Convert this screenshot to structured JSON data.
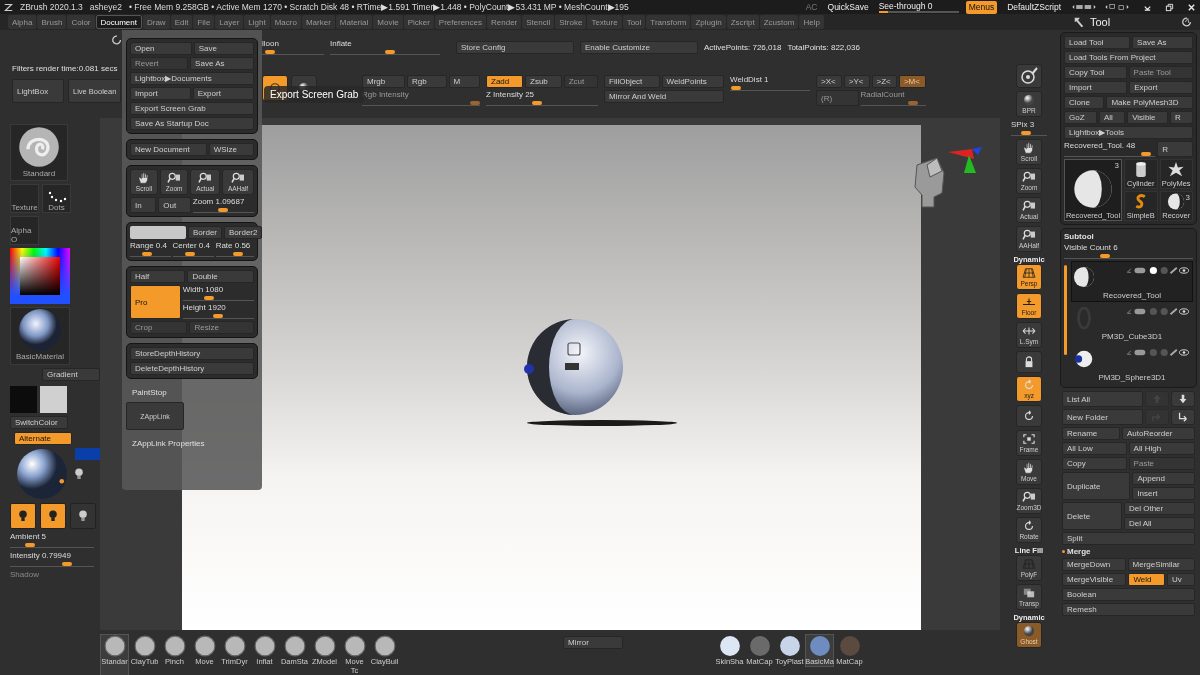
{
  "title_bar": {
    "app": "ZBrush 2020.1.3",
    "user": "asheye2",
    "stats": "• Free Mem 9.258GB • Active Mem 1270 • Scratch Disk 48 •  RTime▶1.591 Timer▶1.448 • PolyCount▶53.431 MP  • MeshCount▶195",
    "ac": "AC",
    "quicksave": "QuickSave",
    "see_through": {
      "label": "See-through  0",
      "level": 0.12
    },
    "menus": {
      "label": "Menus",
      "on": true
    },
    "script": "DefaultZScript"
  },
  "menu_bar": {
    "items": [
      {
        "label": "Alpha",
        "selected": false
      },
      {
        "label": "Brush",
        "selected": false
      },
      {
        "label": "Color",
        "selected": false
      },
      {
        "label": "Document",
        "selected": true
      },
      {
        "label": "Draw",
        "selected": false
      },
      {
        "label": "Edit",
        "selected": false
      },
      {
        "label": "File",
        "selected": false
      },
      {
        "label": "Layer",
        "selected": false
      },
      {
        "label": "Light",
        "selected": false
      },
      {
        "label": "Macro",
        "selected": false
      },
      {
        "label": "Marker",
        "selected": false
      },
      {
        "label": "Material",
        "selected": false
      },
      {
        "label": "Movie",
        "selected": false
      },
      {
        "label": "Picker",
        "selected": false
      },
      {
        "label": "Preferences",
        "selected": false
      },
      {
        "label": "Render",
        "selected": false
      },
      {
        "label": "Stencil",
        "selected": false
      },
      {
        "label": "Stroke",
        "selected": false
      },
      {
        "label": "Texture",
        "selected": false
      },
      {
        "label": "Tool",
        "selected": false
      },
      {
        "label": "Transform",
        "selected": false
      },
      {
        "label": "Zplugin",
        "selected": false
      },
      {
        "label": "Zscript",
        "selected": false
      },
      {
        "label": "Zcustom",
        "selected": false
      },
      {
        "label": "Help",
        "selected": false
      }
    ],
    "palette_title": "Tool"
  },
  "left_shelf": {
    "filter_text": "Filters render time:0.081 secs",
    "lightbox": "LightBox",
    "live_boolean": "Live Boolean",
    "brush": "Standard",
    "texture": "Texture",
    "stroke": "Dots",
    "alpha": "Alpha O",
    "material": "BasicMaterial",
    "gradient": "Gradient",
    "switch_color": "SwitchColor",
    "alternate": {
      "label": "Alternate",
      "on": true
    },
    "lights": [
      {
        "on": true
      },
      {
        "on": true
      },
      {
        "on": false
      }
    ],
    "ambient": {
      "label": "Ambient 5",
      "level": 0.2
    },
    "intensity": {
      "label": "Intensity 0.79949",
      "level": 0.7
    },
    "shadow": "Shadow"
  },
  "top_toolbar": {
    "row": [
      {
        "kind": "slider",
        "label": "lloon",
        "level": 0.05,
        "disabled": false
      },
      {
        "kind": "slider",
        "label": "Inflate",
        "level": 0.55,
        "disabled": false
      },
      {
        "kind": "button",
        "label": "Store Config",
        "on": false,
        "disabled": false
      },
      {
        "kind": "button",
        "label": "Enable Customize",
        "on": false,
        "disabled": false
      },
      {
        "kind": "text",
        "label": "ActivePoints: 726,018"
      },
      {
        "kind": "text",
        "label": "TotalPoints: 822,036"
      }
    ],
    "groups": [
      {
        "top": [
          {
            "kind": "button",
            "label": "Mrgb",
            "on": false,
            "disabled": false
          },
          {
            "kind": "button",
            "label": "Rgb",
            "on": false,
            "disabled": false
          },
          {
            "kind": "button",
            "label": "M",
            "on": false,
            "disabled": false
          }
        ],
        "bottom": [
          {
            "kind": "slider",
            "label": "Rgb Intensity",
            "level": 1,
            "disabled": true
          }
        ]
      },
      {
        "top": [
          {
            "kind": "button",
            "label": "Zadd",
            "on": true,
            "disabled": false
          },
          {
            "kind": "button",
            "label": "Zsub",
            "on": false,
            "disabled": false
          },
          {
            "kind": "button",
            "label": "Zcut",
            "on": false,
            "disabled": true
          }
        ],
        "bottom": [
          {
            "kind": "slider",
            "label": "Z Intensity 25",
            "level": 0.45,
            "disabled": false
          }
        ]
      },
      {
        "top": [
          {
            "kind": "button",
            "label": "FillObject",
            "on": false,
            "disabled": false
          },
          {
            "kind": "button",
            "label": "WeldPoints",
            "on": false,
            "disabled": false
          }
        ],
        "bottom": [
          {
            "kind": "button",
            "label": "Mirror And Weld",
            "on": false,
            "disabled": false
          }
        ]
      },
      {
        "top": [
          {
            "kind": "slider",
            "label": "WeldDist 1",
            "level": 0.02,
            "disabled": false
          }
        ]
      },
      {
        "top": [
          {
            "kind": "button",
            "label": ">X<",
            "on": false,
            "disabled": false
          },
          {
            "kind": "button",
            "label": ">Y<",
            "on": false,
            "disabled": false
          },
          {
            "kind": "button",
            "label": ">Z<",
            "on": false,
            "disabled": false
          },
          {
            "kind": "button",
            "label": ">M<",
            "on": true,
            "disabled": true
          }
        ],
        "bottom": [
          {
            "kind": "button",
            "label": "(R)",
            "on": false,
            "disabled": true
          },
          {
            "kind": "slider",
            "label": "RadialCount",
            "level": 0.85,
            "disabled": true
          }
        ]
      }
    ]
  },
  "tooltip": "Export Screen Grab",
  "document_menu": {
    "groups": [
      {
        "rows": [
          [
            {
              "kind": "button",
              "label": "Open",
              "on": false,
              "disabled": false
            },
            {
              "kind": "button",
              "label": "Save",
              "on": false,
              "disabled": false
            }
          ],
          [
            {
              "kind": "button",
              "label": "Revert",
              "on": false,
              "disabled": true
            },
            {
              "kind": "button",
              "label": "Save As",
              "on": false,
              "disabled": false
            }
          ],
          [
            {
              "kind": "button",
              "label": "Lightbox▶Documents",
              "on": false,
              "disabled": false
            }
          ],
          [
            {
              "kind": "button",
              "label": "Import",
              "on": false,
              "disabled": false
            },
            {
              "kind": "button",
              "label": "Export",
              "on": false,
              "disabled": false
            }
          ],
          [
            {
              "kind": "button",
              "label": "Export Screen Grab",
              "on": false,
              "disabled": false
            }
          ],
          [
            {
              "kind": "button",
              "label": "Save As Startup Doc",
              "on": false,
              "disabled": false
            }
          ]
        ]
      },
      {
        "rows": [
          [
            {
              "kind": "button",
              "label": "New Document",
              "on": false,
              "disabled": false
            },
            {
              "kind": "button",
              "label": "WSize",
              "on": false,
              "disabled": false
            }
          ]
        ]
      },
      {
        "rows": [
          [
            {
              "kind": "hand",
              "label": "Scroll",
              "on": false,
              "disabled": false
            },
            {
              "kind": "magnifier",
              "label": "Zoom",
              "on": false,
              "disabled": false
            },
            {
              "kind": "magnifier",
              "label": "Actual",
              "on": false,
              "disabled": false
            },
            {
              "kind": "magnifier",
              "label": "AAHalf",
              "on": false,
              "disabled": false
            }
          ],
          [
            {
              "kind": "button",
              "label": "In",
              "on": false,
              "disabled": false
            },
            {
              "kind": "button",
              "label": "Out",
              "on": false,
              "disabled": false
            },
            {
              "kind": "slider",
              "label": "Zoom 1.09687",
              "level": 0.5,
              "disabled": false
            }
          ]
        ]
      },
      {
        "rows": [
          [
            {
              "kind": "swatch"
            },
            {
              "kind": "button",
              "label": "Border",
              "on": false,
              "disabled": false
            },
            {
              "kind": "button",
              "label": "Border2",
              "on": false,
              "disabled": false
            }
          ],
          [
            {
              "kind": "slider",
              "label": "Range 0.4",
              "level": 0.4,
              "disabled": false
            },
            {
              "kind": "slider",
              "label": "Center 0.4",
              "level": 0.4,
              "disabled": false
            },
            {
              "kind": "slider",
              "label": "Rate 0.56",
              "level": 0.6,
              "disabled": false
            }
          ]
        ]
      },
      {
        "rows": [
          [
            {
              "kind": "button",
              "label": "Half",
              "on": false,
              "disabled": false
            },
            {
              "kind": "button",
              "label": "Double",
              "on": false,
              "disabled": false
            }
          ],
          [
            {
              "kind": "button",
              "label": "Pro",
              "on": true,
              "disabled": false
            },
            {
              "kind": "stack",
              "items": [
                {
                  "kind": "slider",
                  "label": "Width 1080",
                  "level": 0.35,
                  "disabled": false
                },
                {
                  "kind": "slider",
                  "label": "Height 1920",
                  "level": 0.5,
                  "disabled": false
                }
              ]
            }
          ],
          [
            {
              "kind": "button",
              "label": "Crop",
              "on": false,
              "disabled": true
            },
            {
              "kind": "button",
              "label": "Resize",
              "on": false,
              "disabled": true
            }
          ]
        ]
      },
      {
        "rows": [
          [
            {
              "kind": "button",
              "label": "StoreDepthHistory",
              "on": false,
              "disabled": false
            }
          ],
          [
            {
              "kind": "button",
              "label": "DeleteDepthHistory",
              "on": false,
              "disabled": false
            }
          ]
        ]
      }
    ],
    "paint_stop": "PaintStop",
    "zapplink": "ZAppLink",
    "zapplink_properties": "ZAppLink Properties"
  },
  "right_toolbar": {
    "items": [
      {
        "kind": "lightcap",
        "on": false,
        "disabled": false
      },
      {
        "kind": "sphere",
        "label": "BPR",
        "on": false,
        "disabled": false
      },
      {
        "kind": "slider",
        "label": "SPix 3",
        "level": 0.4,
        "disabled": false
      },
      {
        "kind": "hand",
        "label": "Scroll",
        "on": false,
        "disabled": false
      },
      {
        "kind": "magnifier",
        "label": "Zoom",
        "on": false,
        "disabled": false
      },
      {
        "kind": "magnifier",
        "label": "Actual",
        "on": false,
        "disabled": false
      },
      {
        "kind": "magnifier",
        "label": "AAHalf",
        "on": false,
        "disabled": false
      },
      {
        "kind": "grid",
        "label": "Persp",
        "caption": "Dynamic",
        "on": true,
        "disabled": false
      },
      {
        "kind": "floor",
        "label": "Floor",
        "on": true,
        "disabled": false
      },
      {
        "kind": "arrows",
        "label": "L.Sym",
        "on": false,
        "disabled": false
      },
      {
        "kind": "lock",
        "on": false,
        "disabled": false
      },
      {
        "kind": "rotate",
        "label": "xyz",
        "on": true,
        "disabled": false
      },
      {
        "kind": "rotate",
        "on": false,
        "disabled": false
      },
      {
        "kind": "frame",
        "label": "Frame",
        "on": false,
        "disabled": false
      },
      {
        "kind": "hand",
        "label": "Move",
        "on": false,
        "disabled": false
      },
      {
        "kind": "magnifier",
        "label": "Zoom3D",
        "on": false,
        "disabled": false
      },
      {
        "kind": "rotate",
        "label": "Rotate",
        "on": false,
        "disabled": false
      },
      {
        "kind": "grid",
        "label": "PolyF",
        "caption": "Line Fill",
        "on": false,
        "disabled": false
      },
      {
        "kind": "squares",
        "label": "Transp",
        "on": false,
        "disabled": false
      },
      {
        "kind": "sphere",
        "label": "Ghost",
        "caption": "Dynamic",
        "on": true,
        "disabled": true
      }
    ]
  },
  "tool_panel": {
    "rows": [
      [
        {
          "kind": "button",
          "label": "Load Tool",
          "on": false,
          "disabled": false
        },
        {
          "kind": "button",
          "label": "Save As",
          "on": false,
          "disabled": false
        }
      ],
      [
        {
          "kind": "button",
          "label": "Load Tools From Project",
          "on": false,
          "disabled": false
        }
      ],
      [
        {
          "kind": "button",
          "label": "Copy Tool",
          "on": false,
          "disabled": false
        },
        {
          "kind": "button",
          "label": "Paste Tool",
          "on": false,
          "disabled": true
        }
      ],
      [
        {
          "kind": "button",
          "label": "Import",
          "on": false,
          "disabled": false
        },
        {
          "kind": "button",
          "label": "Export",
          "on": false,
          "disabled": false
        }
      ],
      [
        {
          "kind": "button",
          "label": "Clone",
          "on": false,
          "disabled": false
        },
        {
          "kind": "button",
          "label": "Make PolyMesh3D",
          "on": false,
          "disabled": false
        }
      ],
      [
        {
          "kind": "button",
          "label": "GoZ",
          "on": false,
          "disabled": false
        },
        {
          "kind": "button",
          "label": "All",
          "on": false,
          "disabled": false
        },
        {
          "kind": "button",
          "label": "Visible",
          "on": false,
          "disabled": false
        },
        {
          "kind": "button",
          "label": "R",
          "on": false,
          "disabled": false
        }
      ],
      [
        {
          "kind": "button",
          "label": "Lightbox▶Tools",
          "on": false,
          "disabled": false
        }
      ],
      [
        {
          "kind": "slider",
          "label": "Recovered_Tool. 48",
          "level": 0.95,
          "disabled": false
        },
        {
          "kind": "button",
          "label": "R",
          "on": false,
          "disabled": false
        }
      ]
    ],
    "thumbnails": [
      {
        "kind": "sphere",
        "label": "Recovered_Tool",
        "badge": "3",
        "selected": true
      },
      {
        "kind": "cylinder",
        "label": "Cylinder",
        "selected": false
      },
      {
        "kind": "star",
        "label": "PolyMes",
        "selected": false
      },
      {
        "kind": "s-logo",
        "label": "SimpleB",
        "selected": false
      },
      {
        "kind": "sphere",
        "label": "Recover",
        "badge": "3",
        "selected": false
      }
    ],
    "subtool": {
      "title": "Subtool",
      "visible_count": {
        "label": "Visible Count 6",
        "level": 0.3
      },
      "items": [
        {
          "kind": "sphere",
          "name": "Recovered_Tool",
          "selected": true
        },
        {
          "kind": "ring",
          "name": "PM3D_Cube3D1",
          "selected": false
        },
        {
          "kind": "eyeball",
          "name": "PM3D_Sphere3D1",
          "selected": false
        }
      ]
    },
    "actions": [
      [
        {
          "kind": "button",
          "label": "List All",
          "on": false,
          "disabled": false
        },
        {
          "kind": "up",
          "on": false,
          "disabled": true
        },
        {
          "kind": "down",
          "on": false,
          "disabled": false
        }
      ],
      [
        {
          "kind": "button",
          "label": "New Folder",
          "on": false,
          "disabled": false
        },
        {
          "kind": "redo",
          "on": false,
          "disabled": true
        },
        {
          "kind": "turn",
          "on": false,
          "disabled": false
        }
      ],
      [
        {
          "kind": "button",
          "label": "Rename",
          "on": false,
          "disabled": false
        },
        {
          "kind": "button",
          "label": "AutoReorder",
          "on": false,
          "disabled": false
        }
      ],
      [
        {
          "kind": "button",
          "label": "All Low",
          "on": false,
          "disabled": false
        },
        {
          "kind": "button",
          "label": "All High",
          "on": false,
          "disabled": false
        }
      ],
      [
        {
          "kind": "button",
          "label": "Copy",
          "on": false,
          "disabled": false
        },
        {
          "kind": "button",
          "label": "Paste",
          "on": false,
          "disabled": true
        }
      ],
      [
        {
          "kind": "button",
          "label": "Duplicate",
          "on": false,
          "disabled": false
        },
        {
          "kind": "stack",
          "items": [
            {
              "kind": "button",
              "label": "Append",
              "on": false,
              "disabled": false
            },
            {
              "kind": "button",
              "label": "Insert",
              "on": false,
              "disabled": false
            }
          ]
        }
      ],
      [
        {
          "kind": "button",
          "label": "Delete",
          "on": false,
          "disabled": false
        },
        {
          "kind": "stack",
          "items": [
            {
              "kind": "button",
              "label": "Del Other",
              "on": false,
              "disabled": false
            },
            {
              "kind": "button",
              "label": "Del All",
              "on": false,
              "disabled": false
            }
          ]
        }
      ],
      [
        {
          "kind": "button",
          "label": "Split",
          "on": false,
          "disabled": false
        }
      ],
      [
        {
          "kind": "header",
          "label": "Merge"
        }
      ],
      [
        {
          "kind": "button",
          "label": "MergeDown",
          "on": false,
          "disabled": false
        },
        {
          "kind": "button",
          "label": "MergeSimilar",
          "on": false,
          "disabled": false
        }
      ],
      [
        {
          "kind": "button",
          "label": "MergeVisible",
          "on": false,
          "disabled": false
        },
        {
          "kind": "button",
          "label": "Weld",
          "on": true,
          "disabled": false
        },
        {
          "kind": "button",
          "label": "Uv",
          "on": false,
          "disabled": false
        }
      ],
      [
        {
          "kind": "button",
          "label": "Boolean",
          "on": false,
          "disabled": false
        }
      ],
      [
        {
          "kind": "button",
          "label": "Remesh",
          "on": false,
          "disabled": false
        }
      ]
    ]
  },
  "bottom_shelf": {
    "brushes": [
      {
        "label": "Standar",
        "selected": true
      },
      {
        "label": "ClayTub",
        "selected": false
      },
      {
        "label": "Pinch",
        "selected": false
      },
      {
        "label": "Move",
        "selected": false
      },
      {
        "label": "TrimDyr",
        "selected": false
      },
      {
        "label": "Inflat",
        "selected": false
      },
      {
        "label": "DamSta",
        "selected": false
      },
      {
        "label": "ZModel",
        "selected": false
      },
      {
        "label": "Move Tc",
        "selected": false
      },
      {
        "label": "ClayBuil",
        "selected": false
      }
    ],
    "mirror": "Mirror",
    "materials": [
      {
        "label": "SkinSha",
        "color": "#dce6f5",
        "selected": false
      },
      {
        "label": "MatCap",
        "color": "#6a6a6a",
        "selected": false
      },
      {
        "label": "ToyPlast",
        "color": "#c8d4e8",
        "selected": false
      },
      {
        "label": "BasicMa",
        "color": "#6f8cc0",
        "selected": true
      },
      {
        "label": "MatCap",
        "color": "#5a4a40",
        "selected": false
      }
    ]
  }
}
